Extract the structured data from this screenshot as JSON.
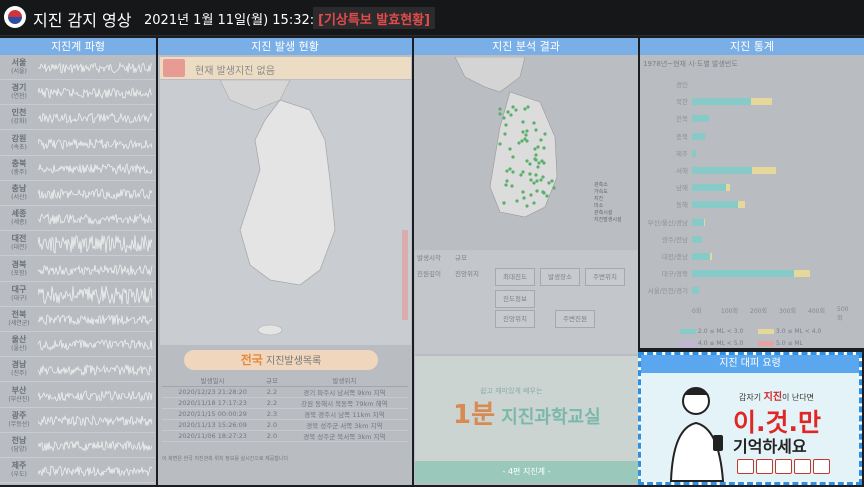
{
  "header": {
    "title": "지진 감지 영상",
    "datetime": "2021년 1월 11일(월) 15:32:17",
    "alert": "[기상특보 발효현황]"
  },
  "panels": {
    "waves": "지진계 파형",
    "occurrence": "지진 발생 현황",
    "analysis": "지진 분석 결과",
    "stats": "지진 통계"
  },
  "stations": [
    {
      "name": "서울",
      "sub": "(서울)"
    },
    {
      "name": "경기",
      "sub": "(연천)"
    },
    {
      "name": "인천",
      "sub": "(강화)"
    },
    {
      "name": "강원",
      "sub": "(속초)"
    },
    {
      "name": "충북",
      "sub": "(충주)"
    },
    {
      "name": "충남",
      "sub": "(서산)"
    },
    {
      "name": "세종",
      "sub": "(세종)"
    },
    {
      "name": "대전",
      "sub": "(대전)"
    },
    {
      "name": "경북",
      "sub": "(포항)"
    },
    {
      "name": "대구",
      "sub": "(대구)"
    },
    {
      "name": "전북",
      "sub": "(세연군)"
    },
    {
      "name": "울산",
      "sub": "(울산)"
    },
    {
      "name": "경남",
      "sub": "(진주)"
    },
    {
      "name": "부산",
      "sub": "(부산진)"
    },
    {
      "name": "광주",
      "sub": "(무등산)"
    },
    {
      "name": "전남",
      "sub": "(담양)"
    },
    {
      "name": "제주",
      "sub": "(우도)"
    }
  ],
  "occurrence": {
    "no_quake": "현재 발생지진 없음",
    "list_title_main": "전국",
    "list_title_rest": " 지진발생목록",
    "columns": [
      "발생일시",
      "규모",
      "발생위치"
    ],
    "rows": [
      [
        "2020/12/23 21:28:20",
        "2.2",
        "경기 파주시 남서쪽 9km 지역"
      ],
      [
        "2020/11/18 17:17:23",
        "2.2",
        "강원 동해시 북동쪽 79km 해역"
      ],
      [
        "2020/11/15 00:00:29",
        "2.3",
        "경북 경주시 남쪽 11km 지역"
      ],
      [
        "2020/11/13 15:26:09",
        "2.0",
        "경북 성주군 서쪽 3km 지역"
      ],
      [
        "2020/11/06 18:27:23",
        "2.0",
        "경북 성주군 북서쪽 3km 지역"
      ]
    ],
    "note": "이 화면은 한국 지진관측 위치 정보를 실시간으로 제공합니다"
  },
  "analysis": {
    "labels": [
      "발생시각",
      "규모",
      "진원깊이",
      "진앙위치",
      "최대진도",
      "발생장소",
      "주변위치",
      "진도정보",
      "진앙위치",
      "주변진원"
    ],
    "legend": [
      "관측소",
      "가속도",
      "지진",
      "미소",
      "관측시설",
      "지진발생시설"
    ],
    "banner_sub": "쉽고 재미있게 배우는",
    "banner_num": "1분",
    "banner_title": " 지진과학교실",
    "banner_bar": "- 4편 지진계 -"
  },
  "stats": {
    "title": "1978년~현재 시·도별 발생빈도",
    "regions": [
      "경인",
      "북한",
      "전북",
      "충북",
      "제주",
      "서해",
      "남해",
      "동해",
      "부산/울산/경남",
      "광주/전남",
      "대전/충남",
      "대구/경북",
      "서울/인천/경기"
    ],
    "bars": [
      [
        0,
        0
      ],
      [
        70,
        25
      ],
      [
        20,
        0
      ],
      [
        15,
        0
      ],
      [
        5,
        0
      ],
      [
        72,
        28
      ],
      [
        40,
        5
      ],
      [
        55,
        8
      ],
      [
        14,
        2
      ],
      [
        12,
        0
      ],
      [
        22,
        2
      ],
      [
        122,
        18
      ],
      [
        8,
        0
      ]
    ],
    "ticks": [
      "0회",
      "100회",
      "200회",
      "300회",
      "400회",
      "500회"
    ],
    "legend": [
      "2.0 ≤ ML < 3.0",
      "3.0 ≤ ML < 4.0",
      "4.0 ≤ ML < 5.0",
      "5.0 ≤ ML"
    ],
    "colors": {
      "c1": "#86cbc7",
      "c2": "#e6d89a",
      "c3": "#c6b4d8",
      "c4": "#e7a3a3"
    }
  },
  "tips": {
    "header": "지진 대피 요령",
    "line1_pre": "갑자기 ",
    "line1_bold": "지진",
    "line1_post": "이 난다면",
    "big": "이.것.만",
    "big2": "기억하세요"
  }
}
